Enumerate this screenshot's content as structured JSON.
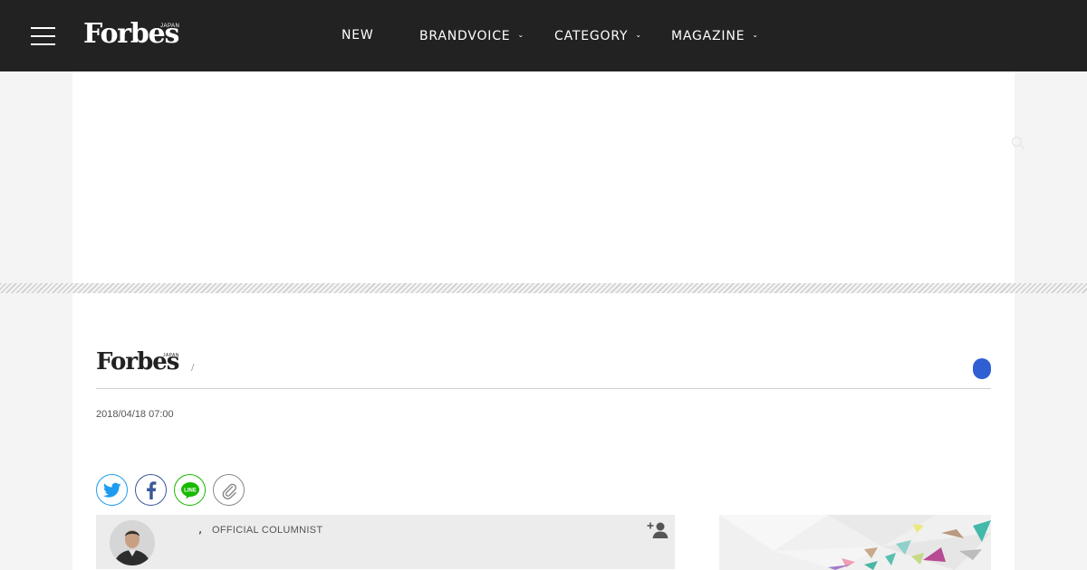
{
  "header": {
    "logo": "Forbes",
    "logo_sub": "JAPAN",
    "nav": [
      {
        "label": "NEW",
        "has_dropdown": false
      },
      {
        "label": "BRANDVOICE",
        "has_dropdown": true
      },
      {
        "label": "CATEGORY",
        "has_dropdown": true
      },
      {
        "label": "MAGAZINE",
        "has_dropdown": true
      }
    ],
    "menu_icon": "hamburger-icon",
    "search_icon": "search-icon"
  },
  "article": {
    "logo": "Forbes",
    "logo_sub": "JAPAN",
    "separator": "/",
    "date": "2018/04/18 07:00",
    "share_buttons": [
      {
        "icon": "twitter-icon",
        "color": "#1d9bf0"
      },
      {
        "icon": "facebook-icon",
        "color": "#3b5998"
      },
      {
        "icon": "line-icon",
        "label": "LINE",
        "color": "#19b900"
      },
      {
        "icon": "link-icon",
        "color": "#888888"
      }
    ],
    "author": {
      "comma": ",",
      "role": "OFFICIAL COLUMNIST",
      "follow_icon": "follow-user-icon"
    }
  },
  "colors": {
    "header_bg": "#222222",
    "accent_blue": "#2f5fd3",
    "page_bg": "#f4f4f4"
  }
}
